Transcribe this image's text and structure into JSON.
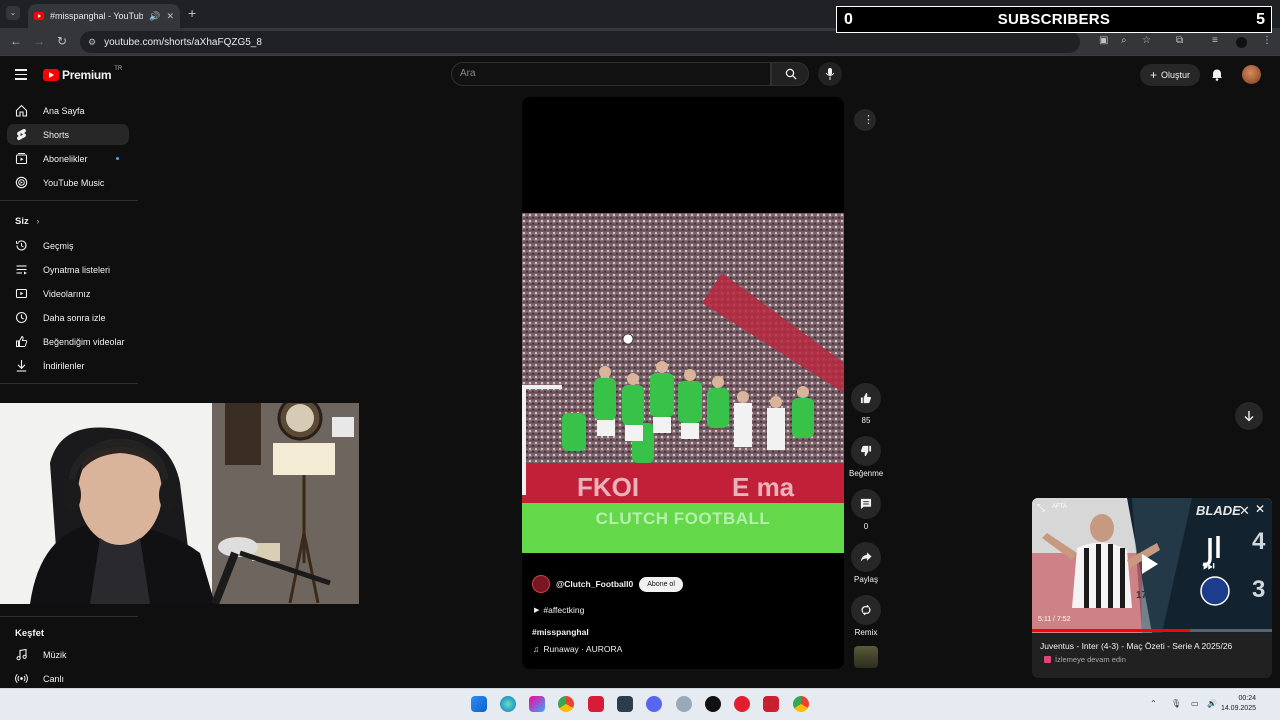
{
  "browser": {
    "tab_title": "#misspanghal - YouTube",
    "url": "youtube.com/shorts/aXhaFQZG5_8"
  },
  "overlay": {
    "subscriber_count": "0",
    "label": "SUBSCRIBERS",
    "right_value": "5"
  },
  "header": {
    "logo_text": "Premium",
    "logo_country": "TR",
    "search_placeholder": "Ara",
    "create_label": "Oluştur"
  },
  "sidebar": {
    "main": [
      {
        "label": "Ana Sayfa",
        "icon": "home-icon"
      },
      {
        "label": "Shorts",
        "icon": "shorts-icon"
      },
      {
        "label": "Abonelikler",
        "icon": "subscriptions-icon"
      },
      {
        "label": "YouTube Music",
        "icon": "youtube-music-icon"
      }
    ],
    "you_heading": "Siz",
    "you": [
      {
        "label": "Geçmiş",
        "icon": "history-icon"
      },
      {
        "label": "Oynatma listeleri",
        "icon": "playlists-icon"
      },
      {
        "label": "Videolarınız",
        "icon": "your-videos-icon"
      },
      {
        "label": "Daha sonra izle",
        "icon": "watch-later-icon"
      },
      {
        "label": "Beğendiğim videolar",
        "icon": "liked-videos-icon"
      },
      {
        "label": "İndirilenler",
        "icon": "downloads-icon"
      }
    ],
    "explore_heading": "Keşfet",
    "explore": [
      {
        "label": "Müzik",
        "icon": "music-icon"
      },
      {
        "label": "Canlı",
        "icon": "live-icon"
      }
    ]
  },
  "short": {
    "watermark": "CLUTCH FOOTBALL",
    "channel": "@Clutch_Football0",
    "subscribe_label": "Abone ol",
    "hashtag": "#affectking",
    "title": "#misspanghal",
    "music": "Runaway · AURORA",
    "like_count": "85",
    "dislike_label": "Beğenme",
    "comment_count": "0",
    "share_label": "Paylaş",
    "remix_label": "Remix"
  },
  "miniplayer": {
    "brand": "BLADE",
    "badge": "AFTA",
    "score_home": "4",
    "score_away": "3",
    "time": "5:11 / 7:52",
    "progress": 0.66,
    "title": "Juventus - Inter (4-3) - Maç Özeti - Serie A 2025/26",
    "subtitle": "İzlemeye devam edin"
  },
  "taskbar": {
    "time": "00:24",
    "date": "14.09.2025"
  },
  "colors": {
    "youtube_red": "#ff0000",
    "background": "#0f0f0f",
    "pitch_green": "#63d94a",
    "kit_green": "#38c24a"
  }
}
